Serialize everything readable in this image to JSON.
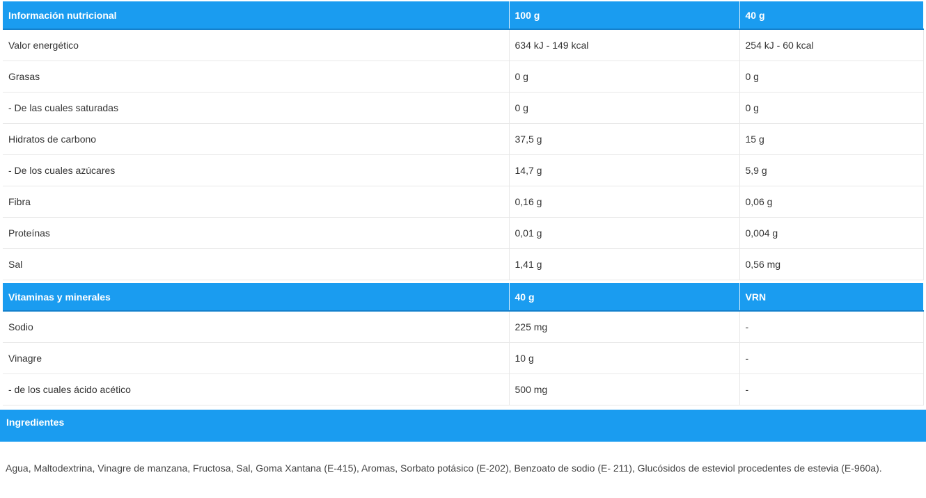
{
  "nutrition": {
    "headers": [
      "Información nutricional",
      "100 g",
      "40 g"
    ],
    "rows": [
      [
        "Valor energético",
        "634 kJ - 149 kcal",
        "254 kJ - 60 kcal"
      ],
      [
        "Grasas",
        "0 g",
        "0 g"
      ],
      [
        "- De las cuales saturadas",
        "0 g",
        "0 g"
      ],
      [
        "Hidratos de carbono",
        "37,5 g",
        "15 g"
      ],
      [
        "- De los cuales azúcares",
        "14,7 g",
        "5,9 g"
      ],
      [
        "Fibra",
        "0,16 g",
        "0,06 g"
      ],
      [
        "Proteínas",
        "0,01 g",
        "0,004 g"
      ],
      [
        "Sal",
        "1,41 g",
        "0,56 mg"
      ]
    ]
  },
  "vitamins": {
    "headers": [
      "Vitaminas y minerales",
      "40 g",
      "VRN"
    ],
    "rows": [
      [
        "Sodio",
        "225 mg",
        "-"
      ],
      [
        "Vinagre",
        "10 g",
        "-"
      ],
      [
        "- de los cuales ácido acético",
        "500 mg",
        "-"
      ]
    ]
  },
  "ingredients": {
    "title": "Ingredientes",
    "text": "Agua, Maltodextrina, Vinagre de manzana, Fructosa, Sal, Goma Xantana (E-415), Aromas, Sorbato potásico (E-202), Benzoato de sodio (E- 211), Glucósidos de esteviol procedentes de estevia (E-960a)."
  },
  "colors": {
    "header_bg": "#1a9cf0",
    "header_text": "#ffffff",
    "body_text": "#333333",
    "border": "#e8e8e8"
  }
}
